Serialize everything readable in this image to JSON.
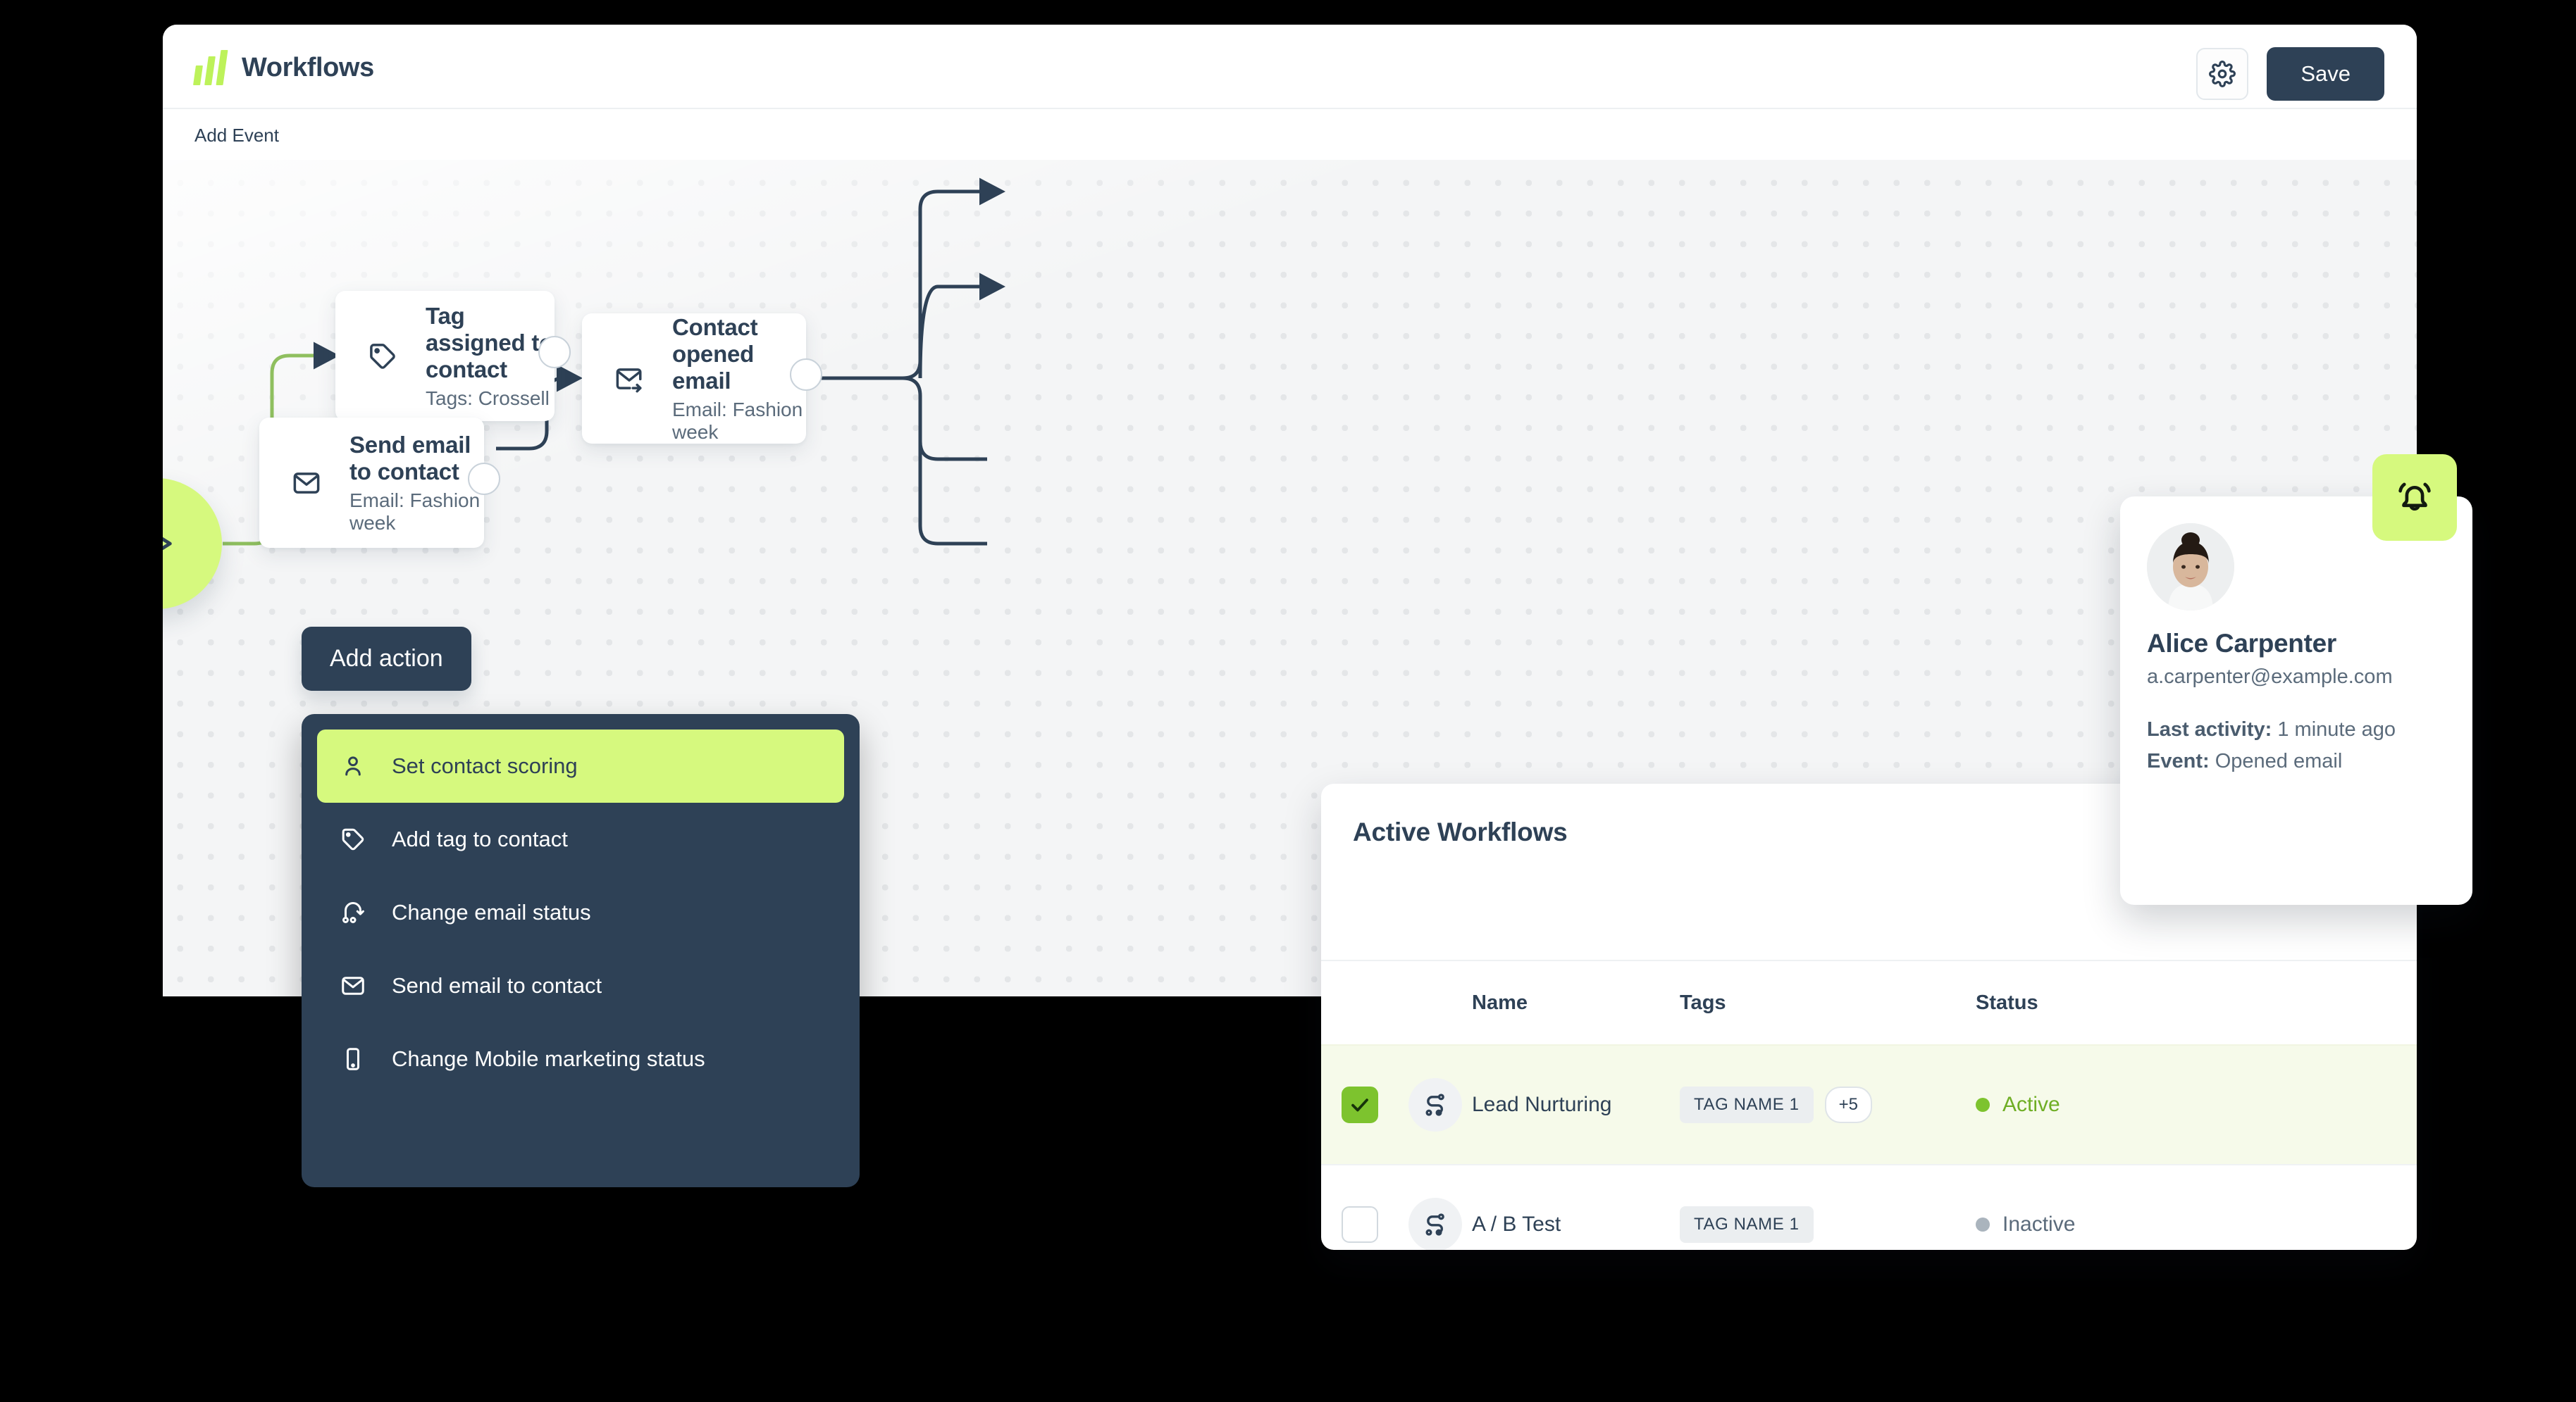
{
  "header": {
    "title": "Workflows",
    "logo_icon": "bar-chart-logo-icon",
    "settings_icon": "gear-icon",
    "save_label": "Save",
    "accent_green": "#d6f97e",
    "dark_navy": "#2e4156"
  },
  "subheader": {
    "label": "Add Event"
  },
  "canvas": {
    "start_node": {
      "icon": "play-icon"
    },
    "nodes": [
      {
        "id": "tag-assigned",
        "icon": "tag-icon",
        "title": "Tag assigned to contact",
        "subtitle": "Tags: Crossell"
      },
      {
        "id": "send-email",
        "icon": "envelope-icon",
        "title": "Send email to contact",
        "subtitle": "Email: Fashion week"
      },
      {
        "id": "contact-opened-email",
        "icon": "envelope-open-arrow-icon",
        "title": "Contact opened email",
        "subtitle": "Email: Fashion week"
      }
    ]
  },
  "add_action": {
    "label": "Add action"
  },
  "action_menu": {
    "items": [
      {
        "label": "Set contact scoring",
        "icon": "person-icon",
        "selected": true
      },
      {
        "label": "Add tag to contact",
        "icon": "tag-icon",
        "selected": false
      },
      {
        "label": "Change email status",
        "icon": "status-icon",
        "selected": false
      },
      {
        "label": "Send email to contact",
        "icon": "envelope-icon",
        "selected": false
      },
      {
        "label": "Change Mobile marketing status",
        "icon": "mobile-icon",
        "selected": false
      }
    ]
  },
  "workflows_card": {
    "title": "Active Workflows",
    "columns": [
      "Name",
      "Tags",
      "Status"
    ],
    "rows": [
      {
        "selected": true,
        "icon": "workflow-icon",
        "name": "Lead Nurturing",
        "tags": [
          "TAG NAME 1"
        ],
        "tags_more": "+5",
        "status": "Active",
        "status_color": "#7dc32e"
      },
      {
        "selected": false,
        "icon": "workflow-icon",
        "name": "A / B  Test",
        "tags": [
          "TAG NAME 1"
        ],
        "tags_more": "",
        "status": "Inactive",
        "status_color": "#aab4bd"
      }
    ]
  },
  "contact_card": {
    "avatar_icon": "contact-avatar",
    "name": "Alice Carpenter",
    "email": "a.carpenter@example.com",
    "last_activity_label": "Last activity:",
    "last_activity_value": "1 minute ago",
    "event_label": "Event:",
    "event_value": "Opened email",
    "bell_icon": "bell-ringing-icon"
  }
}
